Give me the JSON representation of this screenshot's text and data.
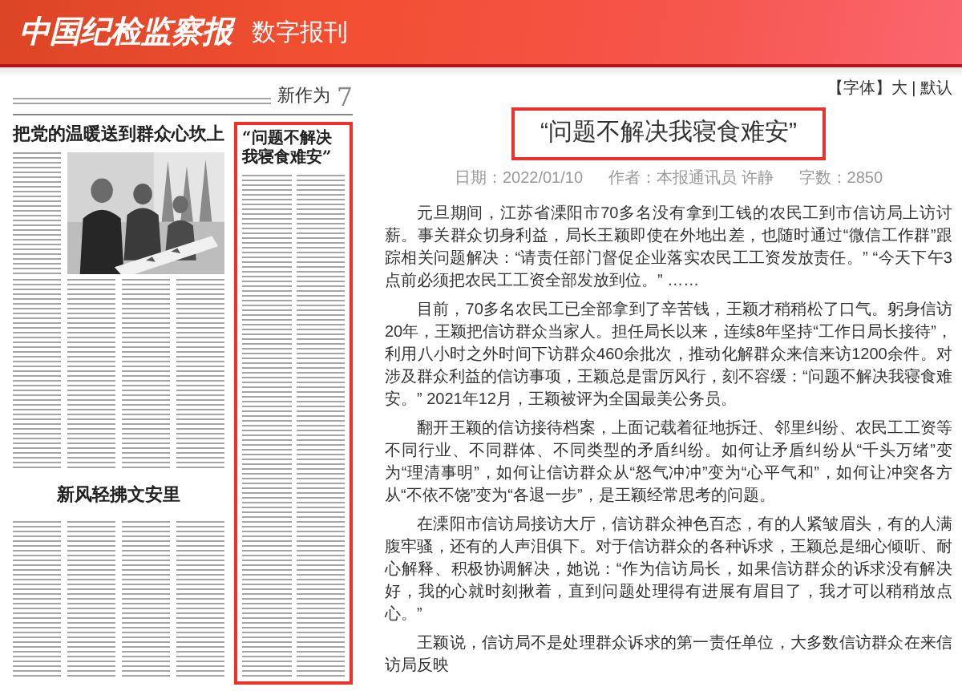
{
  "header": {
    "logo": "中国纪检监察报",
    "subtitle": "数字报刊"
  },
  "page": {
    "section": "新作为",
    "number": "7",
    "headlines": [
      "把党的温暖送到群众心坎上",
      "新风轻拂文安里"
    ],
    "highlight_title": "“问题不解决我寝食难安”"
  },
  "article": {
    "font_control": "【字体】大 | 默认",
    "title": "“问题不解决我寝食难安”",
    "meta": [
      "日期：2022/01/10",
      "作者：本报通讯员 许静",
      "字数：2850"
    ],
    "paragraphs": [
      "元旦期间，江苏省溧阳市70多名没有拿到工钱的农民工到市信访局上访讨薪。事关群众切身利益，局长王颖即使在外地出差，也随时通过“微信工作群”跟踪相关问题解决：“请责任部门督促企业落实农民工工资发放责任。” “今天下午3点前必须把农民工工资全部发放到位。” ……",
      "目前，70多名农民工已全部拿到了辛苦钱，王颖才稍稍松了口气。躬身信访20年，王颖把信访群众当家人。担任局长以来，连续8年坚持“工作日局长接待”，利用八小时之外时间下访群众460余批次，推动化解群众来信来访1200余件。对涉及群众利益的信访事项，王颖总是雷厉风行，刻不容缓：“问题不解决我寝食难安。” 2021年12月，王颖被评为全国最美公务员。",
      "翻开王颖的信访接待档案，上面记载着征地拆迁、邻里纠纷、农民工工资等不同行业、不同群体、不同类型的矛盾纠纷。如何让矛盾纠纷从“千头万绪”变为“理清事明”，如何让信访群众从“怒气冲冲”变为“心平气和”，如何让冲突各方从“不依不饶”变为“各退一步”，是王颖经常思考的问题。",
      "在溧阳市信访局接访大厅，信访群众神色百态，有的人紧皱眉头，有的人满腹牢骚，还有的人声泪俱下。对于信访群众的各种诉求，王颖总是细心倾听、耐心解释、积极协调解决，她说：“作为信访局长，如果信访群众的诉求没有解决好，我的心就时刻揪着，直到问题处理得有进展有眉目了，我才可以稍稍放点心。”",
      "王颖说，信访局不是处理群众诉求的第一责任单位，大多数信访群众在来信访局反映"
    ]
  }
}
